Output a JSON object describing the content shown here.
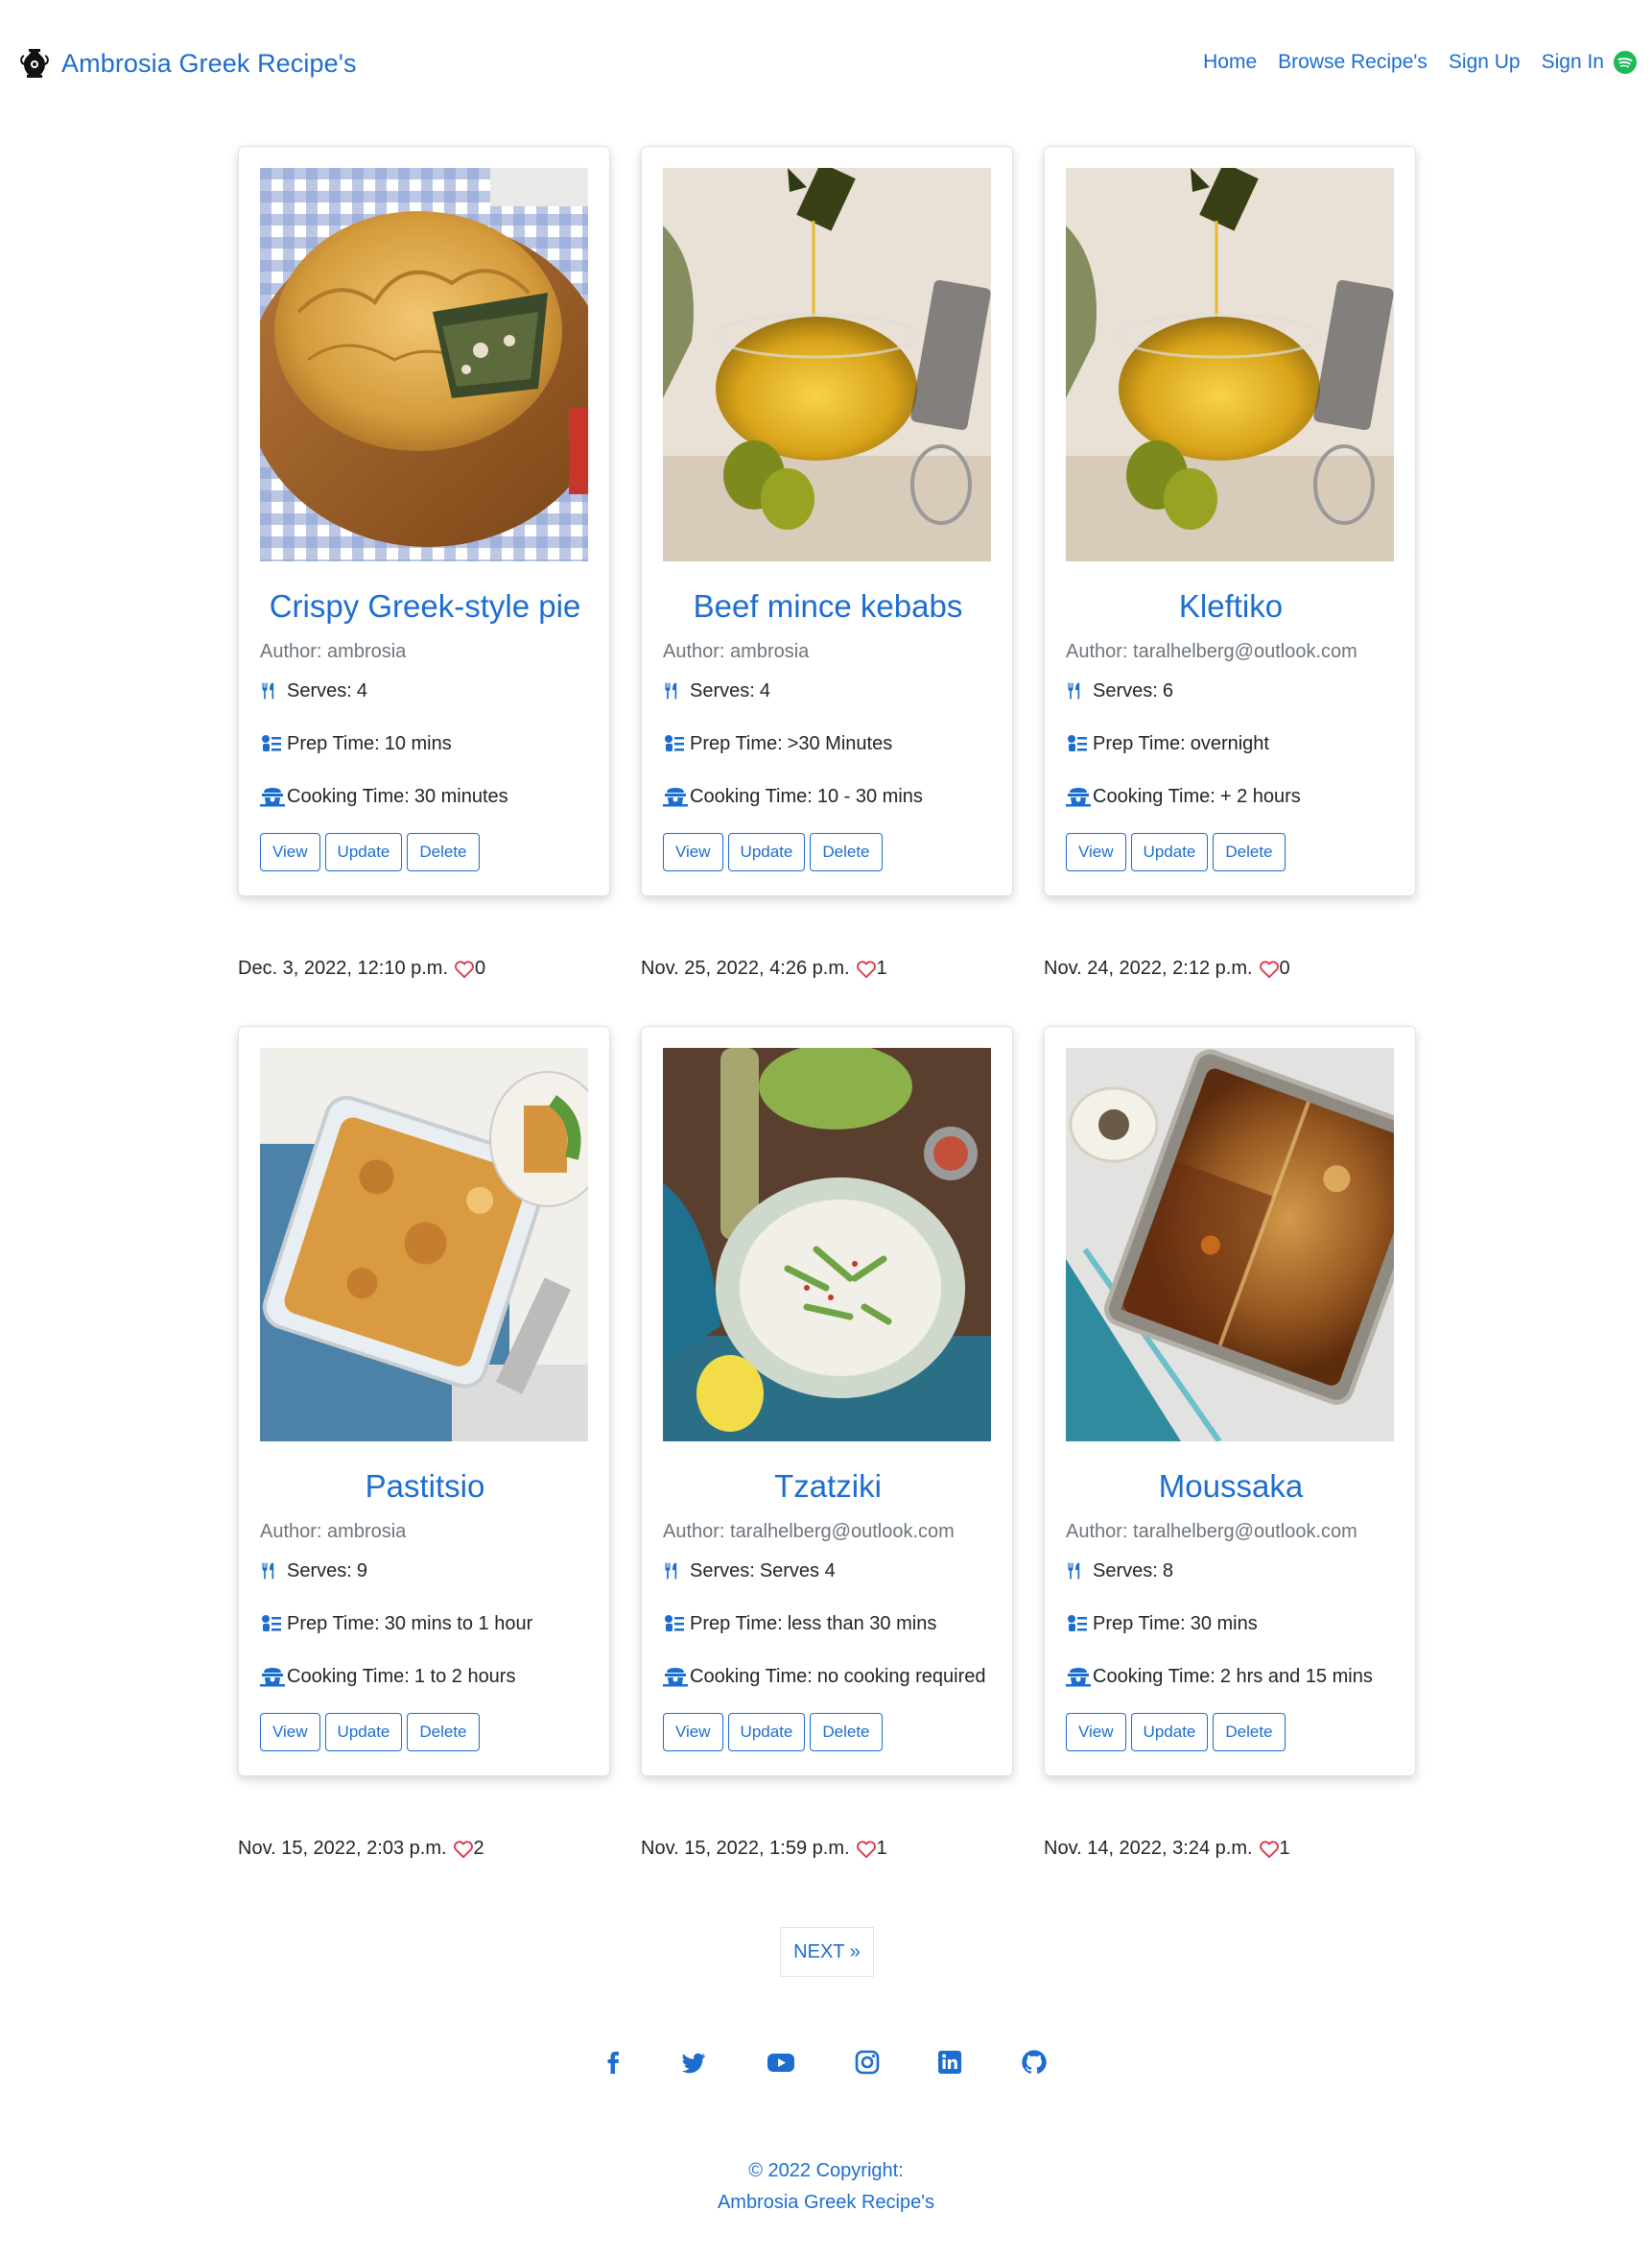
{
  "navbar": {
    "brand": "Ambrosia Greek Recipe's",
    "links": [
      "Home",
      "Browse Recipe's",
      "Sign Up",
      "Sign In"
    ],
    "icon": "spotify-icon"
  },
  "labels": {
    "author_prefix": "Author:",
    "serves": "Serves:",
    "prep": "Prep Time:",
    "cooking": "Cooking Time:",
    "view": "View",
    "update": "Update",
    "delete": "Delete"
  },
  "recipes": [
    {
      "title": "Crispy Greek-style pie",
      "author": "ambrosia",
      "serves": "4",
      "prep": "10 mins",
      "cooking": "30 minutes",
      "date": "Dec. 3, 2022, 12:10 p.m.",
      "likes": "0",
      "image": "spanakopita-pie-photo"
    },
    {
      "title": "Beef mince kebabs",
      "author": "ambrosia",
      "serves": "4",
      "prep": ">30 Minutes",
      "cooking": "10 - 30 mins",
      "date": "Nov. 25, 2022, 4:26 p.m.",
      "likes": "1",
      "image": "olive-oil-photo"
    },
    {
      "title": "Kleftiko",
      "author": "taralhelberg@outlook.com",
      "serves": "6",
      "prep": "overnight",
      "cooking": "+ 2 hours",
      "date": "Nov. 24, 2022, 2:12 p.m.",
      "likes": "0",
      "image": "olive-oil-photo"
    },
    {
      "title": "Pastitsio",
      "author": "ambrosia",
      "serves": "9",
      "prep": "30 mins to 1 hour",
      "cooking": "1 to 2 hours",
      "date": "Nov. 15, 2022, 2:03 p.m.",
      "likes": "2",
      "image": "pastitsio-bake-photo"
    },
    {
      "title": "Tzatziki",
      "author": "taralhelberg@outlook.com",
      "serves": "Serves 4",
      "prep": "less than 30 mins",
      "cooking": "no cooking required",
      "date": "Nov. 15, 2022, 1:59 p.m.",
      "likes": "1",
      "image": "tzatziki-bowl-photo"
    },
    {
      "title": "Moussaka",
      "author": "taralhelberg@outlook.com",
      "serves": "8",
      "prep": "30 mins",
      "cooking": "2 hrs and 15 mins",
      "date": "Nov. 14, 2022, 3:24 p.m.",
      "likes": "1",
      "image": "moussaka-tray-photo"
    }
  ],
  "pagination": {
    "next": "NEXT »"
  },
  "footer": {
    "socials": [
      "facebook-icon",
      "twitter-icon",
      "youtube-icon",
      "instagram-icon",
      "linkedin-icon",
      "github-icon"
    ],
    "copyright": "© 2022 Copyright:",
    "site_name": "Ambrosia Greek Recipe's"
  },
  "colors": {
    "accent": "#1c6dd0",
    "heart": "#dc3545",
    "spotify": "#1db954"
  }
}
